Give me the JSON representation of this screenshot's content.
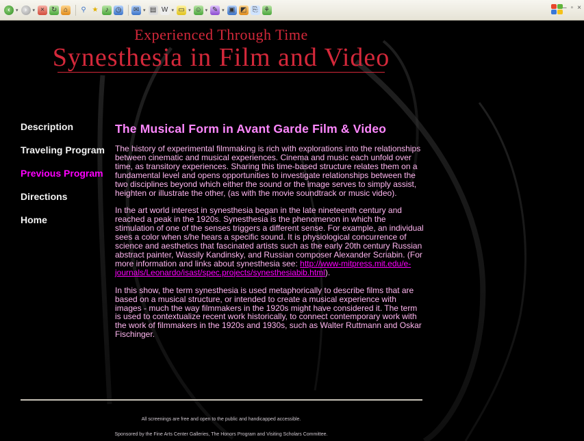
{
  "header": {
    "subtitle": "Experienced Through Time",
    "title": "Synesthesia in Film and Video"
  },
  "nav": {
    "items": [
      {
        "label": "Description",
        "active": false
      },
      {
        "label": "Traveling Program",
        "active": false
      },
      {
        "label": "Previous Program",
        "active": true
      },
      {
        "label": "Directions",
        "active": false
      },
      {
        "label": "Home",
        "active": false
      }
    ]
  },
  "main": {
    "heading": "The Musical Form in Avant Garde Film & Video",
    "paragraph1": "The history of experimental filmmaking is rich with explorations into the relationships between cinematic and musical experiences. Cinema and music each unfold over time, as transitory experiences. Sharing this time-based structure relates them on a fundamental level and opens opportunities to investigate relationships between the two disciplines beyond which either the sound or the image serves to simply assist, heighten or illustrate the other, (as with the movie soundtrack or music video).",
    "paragraph2_before_link": "In the art world interest in synesthesia began in the late nineteenth century and reached a peak in the 1920s. Synesthesia is the phenomenon in which the stimulation of one of the senses triggers a different sense. For example, an individual sees a color when s/he hears a specific sound. It is physiological concurrence of science and aesthetics that fascinated artists such as the early 20th century Russian abstract painter, Wassily Kandinsky, and Russian composer Alexander Scriabin. (For more information and links about synesthesia see: ",
    "paragraph2_link": "http://www-mitpress.mit.edu/e-journals/Leonardo/isast/spec.projects/synesthesiabib.html",
    "paragraph2_after_link": ").",
    "paragraph3": "In this show, the term synesthesia is used metaphorically to describe films that are based on a musical structure, or intended to create a musical experience with images - much the way filmmakers in the 1920s might have considered it. The term is used to contextualize recent work historically, to connect contemporary work with the work of filmmakers in the 1920s and 1930s, such as Walter Ruttmann and Oskar Fischinger."
  },
  "footer": {
    "line1": "All screenings are free and open to the public and handicapped accessible.",
    "line2": "Sponsored by the Fine Arts Center Galleries, The Honors Program and Visiting Scholars Committee."
  },
  "colors": {
    "background": "#000000",
    "title": "#d4283a",
    "heading": "#ff88ff",
    "body_text": "#ffb6f0",
    "active_nav": "#ff00ff"
  },
  "toolbar": {
    "icons": [
      "back-icon",
      "forward-icon",
      "stop-icon",
      "refresh-icon",
      "home-icon",
      "search-icon",
      "favorites-icon",
      "media-icon",
      "history-icon",
      "mail-icon",
      "print-icon",
      "edit-icon",
      "discuss-icon",
      "messenger-icon",
      "research-icon",
      "window-icon",
      "toolbar-extra-icons"
    ]
  }
}
